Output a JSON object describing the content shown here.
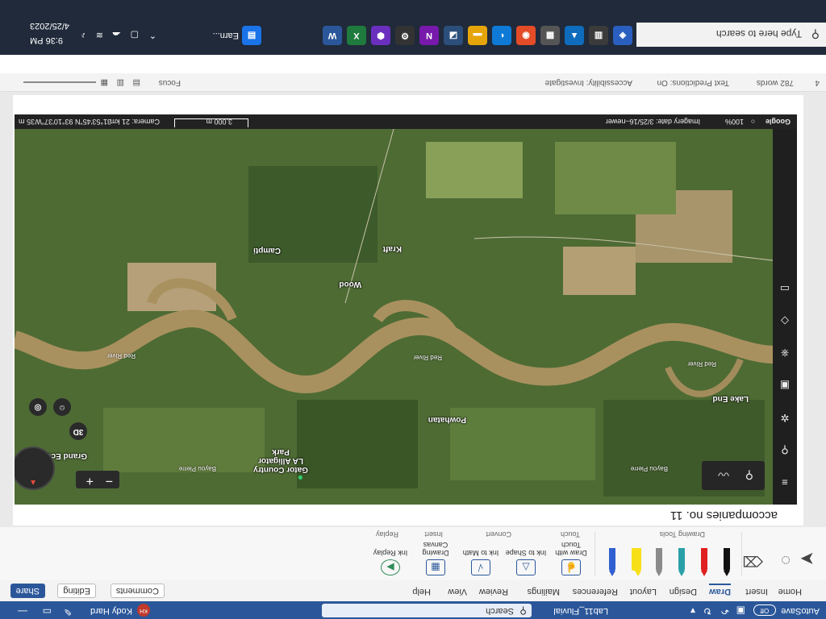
{
  "titlebar": {
    "autosave_label": "AutoSave",
    "autosave_state": "Off",
    "document_title": "Lab11_Fluvial",
    "search_placeholder": "Search",
    "user_name": "Kody Hard",
    "user_initials": "KH"
  },
  "ribbon_tabs": [
    "Home",
    "Insert",
    "Draw",
    "Design",
    "Layout",
    "References",
    "Mailings",
    "Review",
    "View",
    "Help"
  ],
  "active_tab": "Draw",
  "ribbon_actions": {
    "comments": "Comments",
    "editing": "Editing",
    "share": "Share"
  },
  "draw_tools": {
    "pens": [
      {
        "name": "black-pen",
        "color": "#111111"
      },
      {
        "name": "red-pen",
        "color": "#e02020"
      },
      {
        "name": "teal-pen",
        "color": "#2aa0a8"
      },
      {
        "name": "gray-pen",
        "color": "#8a8a8a"
      },
      {
        "name": "yellow-highlighter",
        "color": "#f7e018"
      },
      {
        "name": "galaxy-pen",
        "color": "#3060d0"
      }
    ],
    "group_label": "Drawing Tools",
    "buttons": [
      {
        "label": "Draw with Touch",
        "group": "Touch"
      },
      {
        "label": "Ink to Shape",
        "group": "Convert"
      },
      {
        "label": "Ink to Math",
        "group": "Convert"
      },
      {
        "label": "Drawing Canvas",
        "group": "Insert"
      },
      {
        "label": "Ink Replay",
        "group": "Replay"
      }
    ]
  },
  "document": {
    "heading": "accompanies no. 11"
  },
  "map": {
    "labels": {
      "place_1": "Gator Country LA Alligator Park",
      "place_2": "Powhatan",
      "place_3": "Wood",
      "place_4": "Kraft",
      "place_5": "Campti",
      "place_6": "Lake End",
      "place_7": "Grand Ecore",
      "bayou_1": "Bayou Pierre",
      "bayou_2": "Bayou Pierre",
      "river_1": "Red River",
      "river_2": "Red River",
      "river_3": "Red River"
    },
    "controls": {
      "view_3d": "3D",
      "zoom_in": "+",
      "zoom_out": "−"
    },
    "attribution": {
      "brand": "Google",
      "zoom_pct": "100%",
      "imagery_date": "Imagery date: 3/25/16–newer",
      "coords": "31°53'45\"N 93°10'37\"W",
      "camera": "Camera: 21 km",
      "elevation": "35 m",
      "scale": "3,000 m"
    }
  },
  "statusbar": {
    "words": "782 words",
    "text_predictions": "Text Predictions: On",
    "accessibility": "Accessibility: Investigate",
    "focus": "Focus"
  },
  "taskbar": {
    "search_placeholder": "Type here to search",
    "earnings_label": "Earn...",
    "time": "9:36 PM",
    "date": "4/25/2023"
  }
}
